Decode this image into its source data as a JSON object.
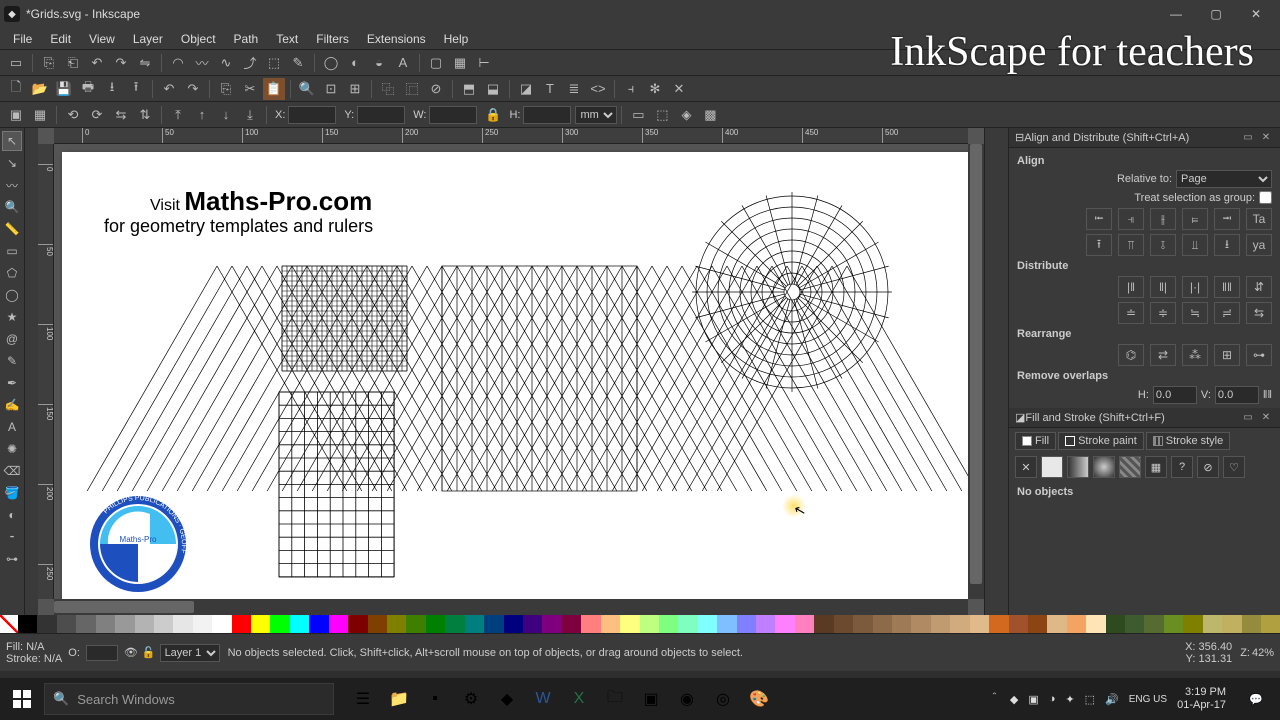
{
  "window": {
    "title": "*Grids.svg - Inkscape"
  },
  "menu": [
    "File",
    "Edit",
    "View",
    "Layer",
    "Object",
    "Path",
    "Text",
    "Filters",
    "Extensions",
    "Help"
  ],
  "watermark": "InkScape for teachers",
  "tooloptions": {
    "x_label": "X:",
    "y_label": "Y:",
    "w_label": "W:",
    "h_label": "H:",
    "x": "",
    "y": "",
    "w": "",
    "h": "",
    "unit": "mm"
  },
  "align_panel": {
    "title": "Align and Distribute (Shift+Ctrl+A)",
    "heading_align": "Align",
    "relative_label": "Relative to:",
    "relative_value": "Page",
    "treat_group": "Treat selection as group:",
    "heading_distribute": "Distribute",
    "heading_rearrange": "Rearrange",
    "heading_overlaps": "Remove overlaps",
    "h_label": "H:",
    "h_val": "0.0",
    "v_label": "V:",
    "v_val": "0.0"
  },
  "fill_panel": {
    "title": "Fill and Stroke (Shift+Ctrl+F)",
    "tab_fill": "Fill",
    "tab_strokepaint": "Stroke paint",
    "tab_strokestyle": "Stroke style",
    "no_objects": "No objects"
  },
  "status": {
    "fill_label": "Fill:",
    "fill_val": "N/A",
    "stroke_label": "Stroke:",
    "stroke_val": "N/A",
    "opacity_label": "O:",
    "layer": "Layer 1",
    "message": "No objects selected. Click, Shift+click, Alt+scroll mouse on top of objects, or drag around objects to select.",
    "x_label": "X:",
    "x": "356.40",
    "y_label": "Y:",
    "y": "131.31",
    "z_label": "Z:",
    "zoom": "42%"
  },
  "taskbar": {
    "search_placeholder": "Search Windows",
    "time": "3:19 PM",
    "date": "01-Apr-17",
    "lang": "ENG US"
  },
  "canvas": {
    "visit": "Visit ",
    "site": "Maths-Pro.com",
    "tagline": "for geometry templates and rulers",
    "logo_ring": "PHILLIPS PUBLICATIONS · GEOFF",
    "logo_center": "Maths-Pro"
  },
  "palette": [
    "#000000",
    "#333333",
    "#4d4d4d",
    "#666666",
    "#808080",
    "#999999",
    "#b3b3b3",
    "#cccccc",
    "#e6e6e6",
    "#f2f2f2",
    "#ffffff",
    "#ff0000",
    "#ffff00",
    "#00ff00",
    "#00ffff",
    "#0000ff",
    "#ff00ff",
    "#7f0000",
    "#7f3f00",
    "#7f7f00",
    "#3f7f00",
    "#007f00",
    "#007f3f",
    "#007f7f",
    "#003f7f",
    "#00007f",
    "#3f007f",
    "#7f007f",
    "#7f003f",
    "#ff7f7f",
    "#ffbf7f",
    "#ffff7f",
    "#bfff7f",
    "#7fff7f",
    "#7fffbf",
    "#7fffff",
    "#7fbfff",
    "#7f7fff",
    "#bf7fff",
    "#ff7fff",
    "#ff7fbf",
    "#5a3a22",
    "#6b4a2f",
    "#7c5a3c",
    "#8d6a49",
    "#9e7a56",
    "#af8a63",
    "#c09a70",
    "#d1aa7d",
    "#e2ba8a",
    "#d2691e",
    "#a0522d",
    "#8b4513",
    "#deb887",
    "#f4a460",
    "#ffe4b5",
    "#2e4b1f",
    "#3e5b2f",
    "#556b2f",
    "#6b8e23",
    "#808000",
    "#bdb76b",
    "#c0b060",
    "#948b3d",
    "#b0a040"
  ]
}
